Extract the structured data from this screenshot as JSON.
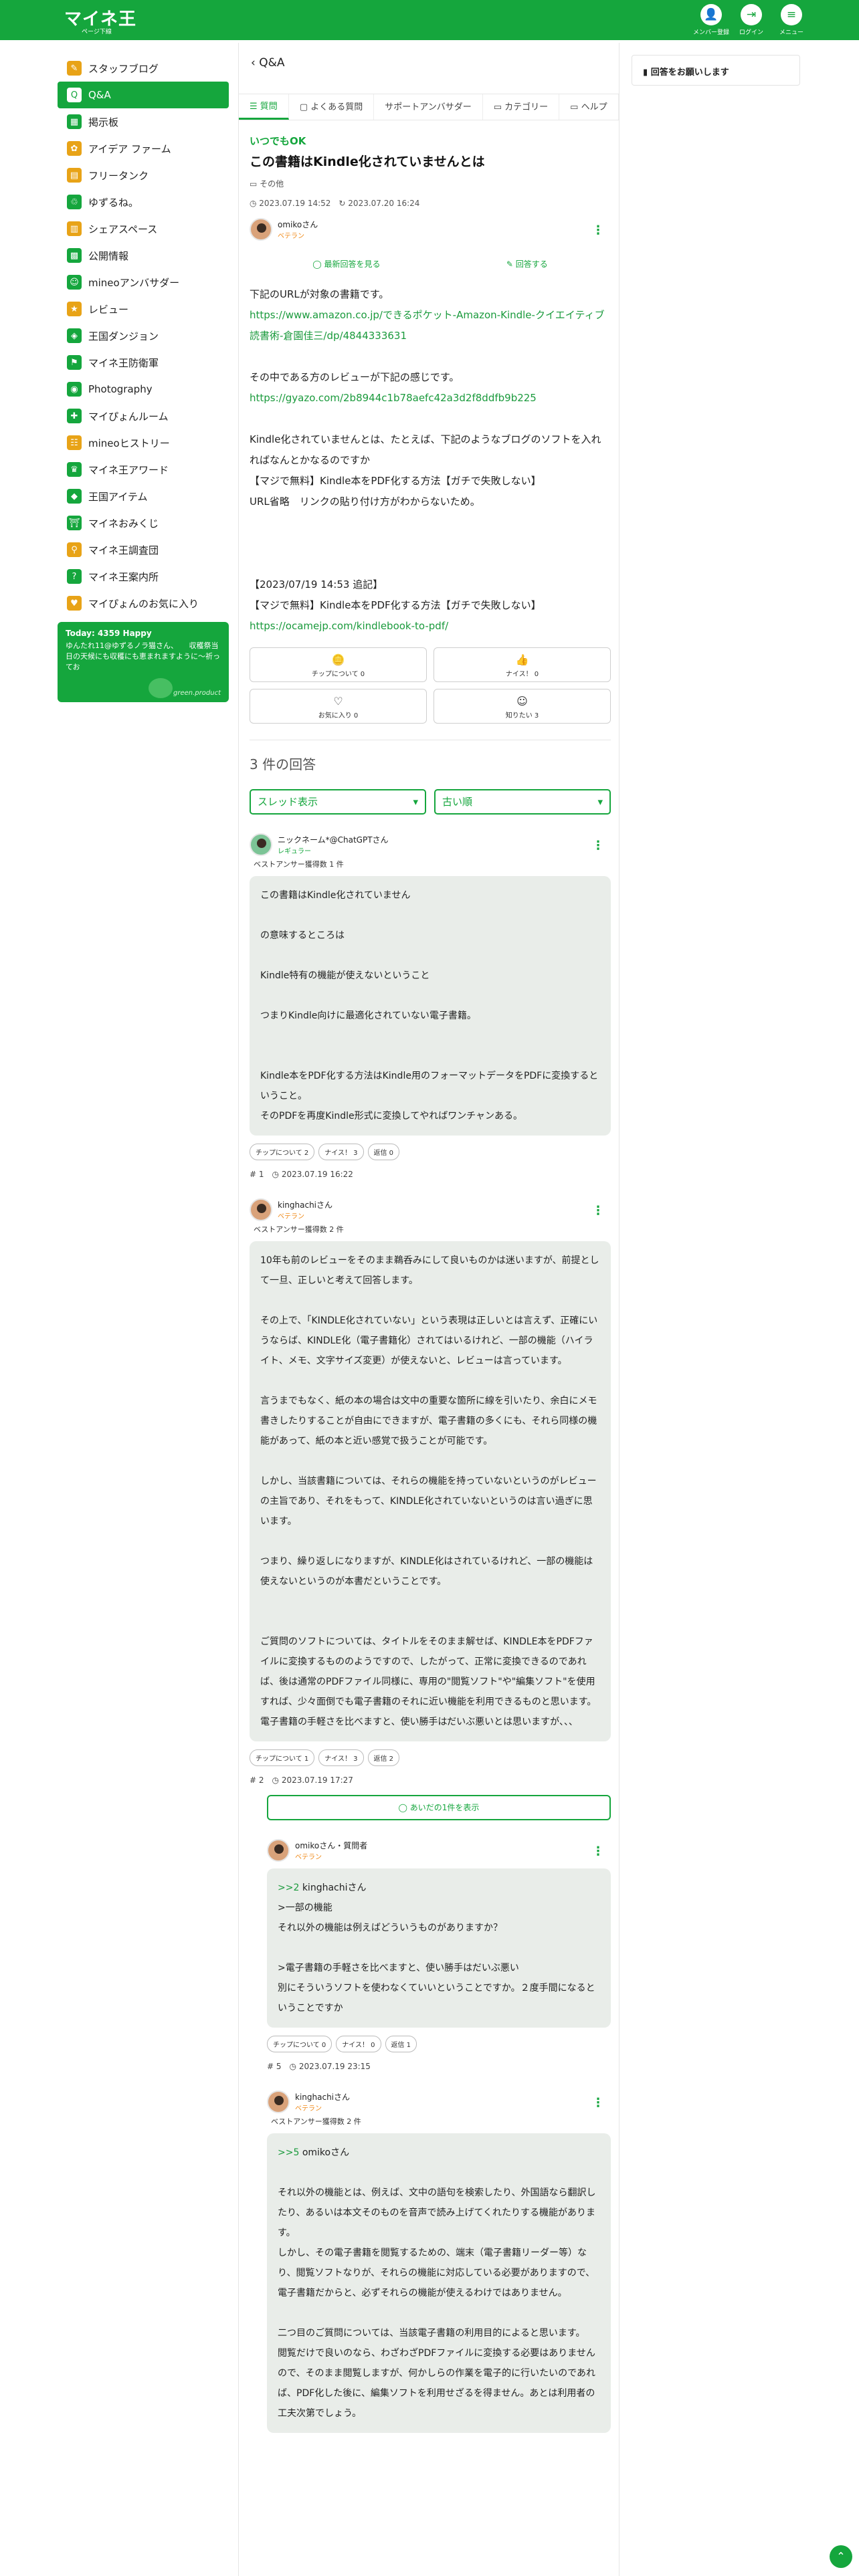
{
  "header": {
    "logo": "マイネ王",
    "logo_sub": "ページ下線",
    "buttons": [
      {
        "label": "メンバー登録",
        "icon": "person-add-icon"
      },
      {
        "label": "ログイン",
        "icon": "login-icon"
      },
      {
        "label": "メニュー",
        "icon": "menu-icon"
      }
    ]
  },
  "sidebar": {
    "items": [
      {
        "label": "スタッフブログ",
        "color": "#e8a317"
      },
      {
        "label": "Q&A",
        "color": "#15a63d"
      },
      {
        "label": "掲示板",
        "color": "#15a63d"
      },
      {
        "label": "アイデア ファーム",
        "color": "#e8a317"
      },
      {
        "label": "フリータンク",
        "color": "#e8a317"
      },
      {
        "label": "ゆずるね。",
        "color": "#15a63d"
      },
      {
        "label": "シェアスペース",
        "color": "#e8a317"
      },
      {
        "label": "公開情報",
        "color": "#15a63d"
      },
      {
        "label": "mineoアンバサダー",
        "color": "#15a63d"
      },
      {
        "label": "レビュー",
        "color": "#e8a317"
      },
      {
        "label": "王国ダンジョン",
        "color": "#15a63d"
      },
      {
        "label": "マイネ王防衛軍",
        "color": "#15a63d"
      },
      {
        "label": "Photography",
        "color": "#15a63d"
      },
      {
        "label": "マイぴょんルーム",
        "color": "#15a63d"
      },
      {
        "label": "mineoヒストリー",
        "color": "#e8a317"
      },
      {
        "label": "マイネ王アワード",
        "color": "#15a63d"
      },
      {
        "label": "王国アイテム",
        "color": "#15a63d"
      },
      {
        "label": "マイネおみくじ",
        "color": "#15a63d"
      },
      {
        "label": "マイネ王調査団",
        "color": "#e8a317"
      },
      {
        "label": "マイネ王案内所",
        "color": "#15a63d"
      },
      {
        "label": "マイぴょんのお気に入り",
        "color": "#e8a317"
      }
    ],
    "banner": {
      "title": "Today: 4359 Happy",
      "text": "ゆんたれ11@ゆずるノラ猫さん、　　収穫祭当日の天候にも収穫にも恵まれますように〜祈ってお",
      "brand": "green.product"
    }
  },
  "main": {
    "breadcrumb": "Q&A",
    "tabs": [
      "質問",
      "よくある質問",
      "サポートアンバサダー",
      "カテゴリー",
      "ヘルプ"
    ],
    "question": {
      "badge": "いつでもOK",
      "title": "この書籍はKindle化されていませんとは",
      "category": "その他",
      "posted": "2023.07.19 14:52",
      "updated": "2023.07.20 16:24",
      "user": "omikoさん",
      "rank": "ベテラン",
      "action_latest": "最新回答を見る",
      "action_answer": "回答する",
      "body1": "下記のURLが対象の書籍です。",
      "link1": "https://www.amazon.co.jp/できるポケット-Amazon-Kindle-クイエイティブ読書術-倉園佳三/dp/4844333631",
      "body2": "その中である方のレビューが下記の感じです。",
      "link2": "https://gyazo.com/2b8944c1b78aefc42a3d2f8ddfb9b225",
      "body3": "Kindle化されていませんとは、たとえば、下記のようなブログのソフトを入れればなんとかなるのですか\n【マジで無料】Kindle本をPDF化する方法【ガチで失敗しない】\nURL省略　リンクの貼り付け方がわからないため。\n\n\n\n【2023/07/19 14:53 追記】\n【マジで無料】Kindle本をPDF化する方法【ガチで失敗しない】",
      "link3": "https://ocamejp.com/kindlebook-to-pdf/",
      "buttons": [
        {
          "label": "チップについて 0",
          "icon": "coin-icon"
        },
        {
          "label": "ナイス！ 0",
          "icon": "thumbs-up-icon"
        },
        {
          "label": "お気に入り 0",
          "icon": "heart-icon"
        },
        {
          "label": "知りたい 3",
          "icon": "wonder-icon"
        }
      ]
    },
    "answers_count": "3 件の回答",
    "sort1": "スレッド表示",
    "sort2": "古い順",
    "answers": [
      {
        "user": "ニックネーム*@ChatGPTさん",
        "rank": "レギュラー",
        "best": "ベストアンサー獲得数 1 件",
        "body": "この書籍はKindle化されていません\n\nの意味するところは\n\nKindle特有の機能が使えないということ\n\nつまりKindle向けに最適化されていない電子書籍。\n\n\nKindle本をPDF化する方法はKindle用のフォーマットデータをPDFに変換するということ。\nそのPDFを再度Kindle形式に変換してやればワンチャンある。",
        "chips": [
          "チップについて 2",
          "ナイス！ 3",
          "返信 0"
        ],
        "num": "# 1",
        "date": "2023.07.19 16:22"
      },
      {
        "user": "kinghachiさん",
        "rank": "ベテラン",
        "best": "ベストアンサー獲得数 2 件",
        "body": "10年も前のレビューをそのまま鵜呑みにして良いものかは迷いますが、前提として一旦、正しいと考えて回答します。\n\nその上で、「KINDLE化されていない」という表現は正しいとは言えず、正確にいうならば、KINDLE化（電子書籍化）されてはいるけれど、一部の機能（ハイライト、メモ、文字サイズ変更）が使えないと、レビューは言っています。\n\n言うまでもなく、紙の本の場合は文中の重要な箇所に線を引いたり、余白にメモ書きしたりすることが自由にできますが、電子書籍の多くにも、それら同様の機能があって、紙の本と近い感覚で扱うことが可能です。\n\nしかし、当該書籍については、それらの機能を持っていないというのがレビューの主旨であり、それをもって、KINDLE化されていないというのは言い過ぎに思います。\n\nつまり、繰り返しになりますが、KINDLE化はされているけれど、一部の機能は使えないというのが本書だということです。\n\n\nご質問のソフトについては、タイトルをそのまま解せば、KINDLE本をPDFファイルに変換するもののようですので、したがって、正常に変換できるのであれば、後は通常のPDFファイル同様に、専用の\"閲覧ソフト\"や\"編集ソフト\"を使用すれば、少々面倒でも電子書籍のそれに近い機能を利用できるものと思います。\n電子書籍の手軽さを比べますと、使い勝手はだいぶ悪いとは思いますが、、、",
        "chips": [
          "チップについて 1",
          "ナイス！ 3",
          "返信 2"
        ],
        "num": "# 2",
        "date": "2023.07.19 17:27"
      }
    ],
    "show_more": "あいだの1件を表示",
    "replies": [
      {
        "user": "omikoさん・質問者",
        "rank": "ベテラン",
        "ref": ">>2",
        "ref_name": "kinghachiさん",
        "body": ">一部の機能\nそれ以外の機能は例えばどういうものがありますか？\n\n>電子書籍の手軽さを比べますと、使い勝手はだいぶ悪い\n別にそういうソフトを使わなくていいということですか。２度手間になるということですか",
        "chips": [
          "チップについて 0",
          "ナイス！ 0",
          "返信 1"
        ],
        "num": "# 5",
        "date": "2023.07.19 23:15"
      },
      {
        "user": "kinghachiさん",
        "rank": "ベテラン",
        "best": "ベストアンサー獲得数 2 件",
        "ref": ">>5",
        "ref_name": "omikoさん",
        "body": "それ以外の機能とは、例えば、文中の語句を検索したり、外国語なら翻訳したり、あるいは本文そのものを音声で読み上げてくれたりする機能があります。\nしかし、その電子書籍を閲覧するための、端末（電子書籍リーダー等）なり、閲覧ソフトなりが、それらの機能に対応している必要がありますので、電子書籍だからと、必ずそれらの機能が使えるわけではありません。\n\n二つ目のご質問については、当該電子書籍の利用目的によると思います。\n閲覧だけで良いのなら、わざわざPDFファイルに変換する必要はありませんので、そのまま閲覧しますが、何かしらの作業を電子的に行いたいのであれば、PDF化した後に、編集ソフトを利用せざるを得ません。あとは利用者の工夫次第でしょう。"
      }
    ]
  },
  "right": {
    "notice": "回答をお願いします"
  }
}
